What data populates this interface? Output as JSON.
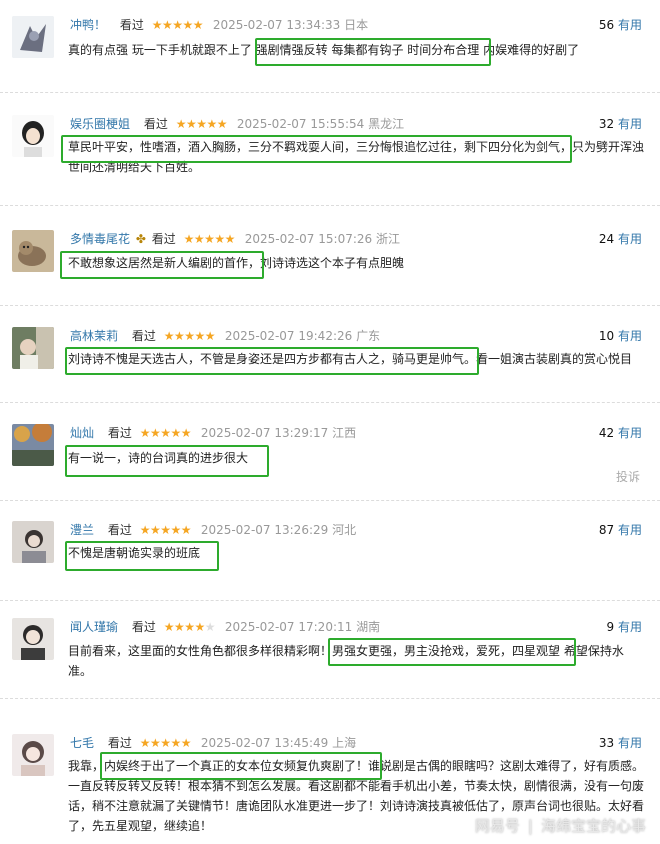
{
  "watched_label": "看过",
  "useful_label": "有用",
  "stars_full": "★★★★★",
  "stars_four": "★★★★",
  "stars_four_empty": "★",
  "report_label": "投诉",
  "watermark": {
    "brand": "网易号",
    "separator": "|",
    "author": "海绵宝宝的心事"
  },
  "colors": {
    "username": "#3377aa",
    "star": "#f5a623",
    "highlight": "#2dab2d",
    "time": "#999999"
  },
  "reviews": [
    {
      "user": "冲鸭！",
      "rating": 5,
      "time": "2025-02-07 13:34:33 日本",
      "useful": "56",
      "content": "真的有点强 玩一下手机就跟不上了 强剧情强反转 每集都有钩子 时间分布合理 内娱难得的好剧了"
    },
    {
      "user": "娱乐圈梗姐",
      "rating": 5,
      "time": "2025-02-07 15:55:54 黑龙江",
      "useful": "32",
      "content": "草民叶平安，性嗜酒，酒入胸肠，三分不羁戏耍人间，三分悔恨追忆过往，剩下四分化为剑气，只为劈开浑浊世间还清明给天下百姓。"
    },
    {
      "user": "多情毒尾花",
      "rating": 5,
      "time": "2025-02-07 15:07:26 浙江",
      "useful": "24",
      "content": "不敢想象这居然是新人编剧的首作，刘诗诗选这个本子有点胆魄"
    },
    {
      "user": "高林茉莉",
      "rating": 5,
      "time": "2025-02-07 19:42:26 广东",
      "useful": "10",
      "content": "刘诗诗不愧是天选古人，不管是身姿还是四方步都有古人之，骑马更是帅气。看一姐演古装剧真的赏心悦目"
    },
    {
      "user": "灿灿",
      "rating": 5,
      "time": "2025-02-07 13:29:17 江西",
      "useful": "42",
      "content": "有一说一，诗的台词真的进步很大"
    },
    {
      "user": "澧兰",
      "rating": 5,
      "time": "2025-02-07 13:26:29 河北",
      "useful": "87",
      "content": "不愧是唐朝诡实录的班底"
    },
    {
      "user": "闻人瑾瑜",
      "rating": 4,
      "time": "2025-02-07 17:20:11 湖南",
      "useful": "9",
      "content": "目前看来，这里面的女性角色都很多样很精彩啊！男强女更强，男主没抢戏，爱死，四星观望 希望保持水准。"
    },
    {
      "user": "七毛",
      "rating": 5,
      "time": "2025-02-07 13:45:49 上海",
      "useful": "33",
      "content": "我靠，内娱终于出了一个真正的女本位女频复仇爽剧了！谁说剧是古偶的眼瞎吗？这剧太难得了，好有质感。一直反转反转又反转！根本猜不到怎么发展。看这剧都不能看手机出小差，节奏太快，剧情很满，没有一句废话，稍不注意就漏了关键情节！唐诡团队水准更进一步了！刘诗诗演技真被低估了，原声台词也很贴。太好看了，先五星观望，继续追！"
    }
  ]
}
